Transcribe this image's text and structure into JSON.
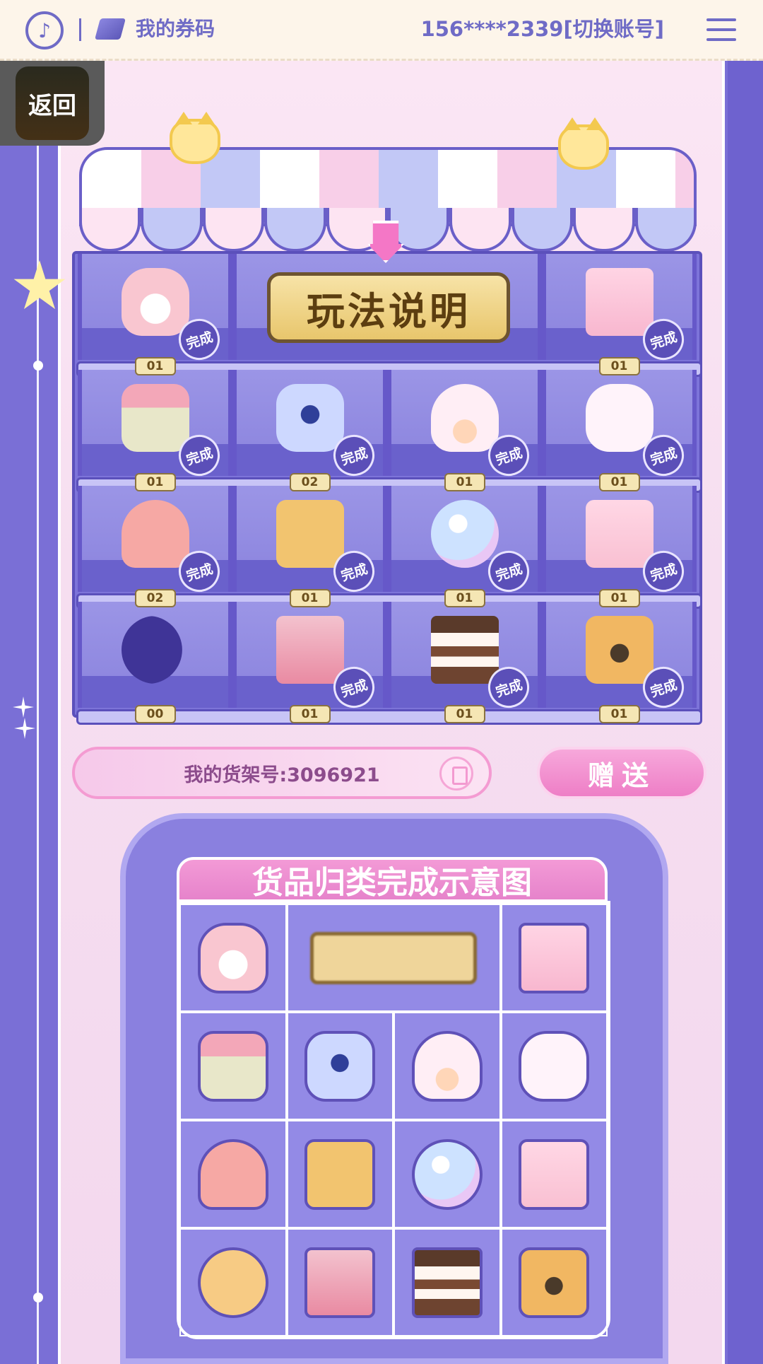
{
  "header": {
    "logo_icon": "music-note-icon",
    "ticket_icon": "ticket-icon",
    "title": "我的券码",
    "account_text": "156****2339[切换账号]",
    "menu_icon": "hamburger-menu-icon"
  },
  "back": {
    "label": "返回"
  },
  "shelf": {
    "howto_label": "玩法说明",
    "done_label": "完成",
    "rows": [
      [
        {
          "icon": "backpack",
          "count": "01",
          "done": true
        },
        {
          "icon": "howto-sign",
          "count": "",
          "done": false
        },
        {
          "icon": "photo-album",
          "count": "01",
          "done": true
        }
      ],
      [
        {
          "icon": "flower-basket",
          "count": "01",
          "done": true
        },
        {
          "icon": "perfume-bottle",
          "count": "02",
          "done": true
        },
        {
          "icon": "shell-ring",
          "count": "01",
          "done": true
        },
        {
          "icon": "bunny-mug",
          "count": "01",
          "done": true
        }
      ],
      [
        {
          "icon": "cat-hat",
          "count": "02",
          "done": true
        },
        {
          "icon": "suitcase",
          "count": "01",
          "done": true
        },
        {
          "icon": "crystal-ball",
          "count": "01",
          "done": true
        },
        {
          "icon": "milk-carton",
          "count": "01",
          "done": true
        }
      ],
      [
        {
          "icon": "moon-silhouette",
          "count": "00",
          "done": false
        },
        {
          "icon": "eyeshadow-palette",
          "count": "01",
          "done": true
        },
        {
          "icon": "chocolate-cake",
          "count": "01",
          "done": true
        },
        {
          "icon": "camera",
          "count": "01",
          "done": true
        }
      ]
    ]
  },
  "shelf_id": {
    "label": "我的货架号:3096921",
    "copy_icon": "copy-icon"
  },
  "gift_button": {
    "label": "赠送"
  },
  "demo": {
    "title": "货品归类完成示意图"
  }
}
